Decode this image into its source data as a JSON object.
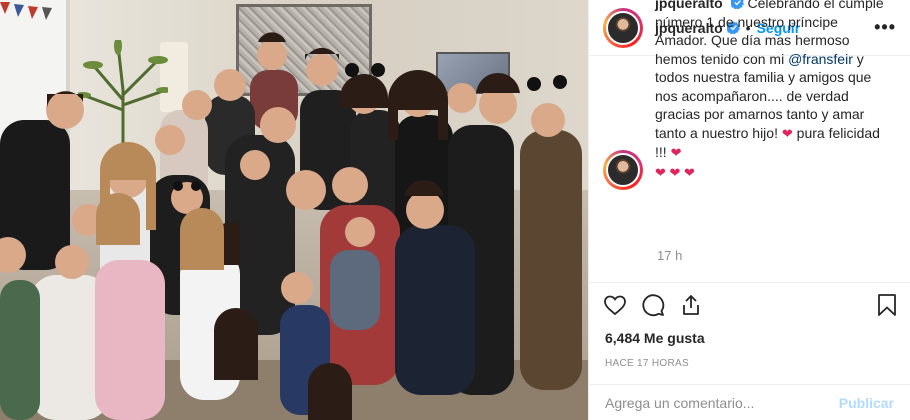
{
  "post": {
    "username": "jpqueralto",
    "follow_label": "Seguir",
    "separator": "•",
    "more_label": "•••",
    "verified_icon": "verified-badge-icon"
  },
  "caption": {
    "username": "jpqueralto",
    "text_part1": " Celebrando el cumple número 1 de nuestro príncipe Amador. Que día mas hermoso hemos tenido con mi ",
    "mention": "@fransfeir",
    "text_part2": " y todos nuestra familia y amigos que nos acompañaron.... de verdad gracias por amarnos tanto y amar tanto a nuestro hijo! ",
    "heart1": "❤",
    "text_part3": " pura felicidad !!! ",
    "heart2": "❤",
    "hearts_line": "❤ ❤ ❤",
    "time_ago": "17 h"
  },
  "actions": {
    "like_icon": "heart-outline-icon",
    "comment_icon": "comment-bubble-icon",
    "share_icon": "share-arrow-icon",
    "save_icon": "bookmark-icon"
  },
  "likes": "6,484 Me gusta",
  "posted_ago": "HACE 17 HORAS",
  "comment": {
    "placeholder": "Agrega un comentario...",
    "publish_label": "Publicar"
  },
  "colors": {
    "link_blue": "#0095f6",
    "mention_blue": "#00376b",
    "heart_red": "#e0245e",
    "muted_gray": "#8e8e8e",
    "publish_disabled": "#b3dbff"
  }
}
